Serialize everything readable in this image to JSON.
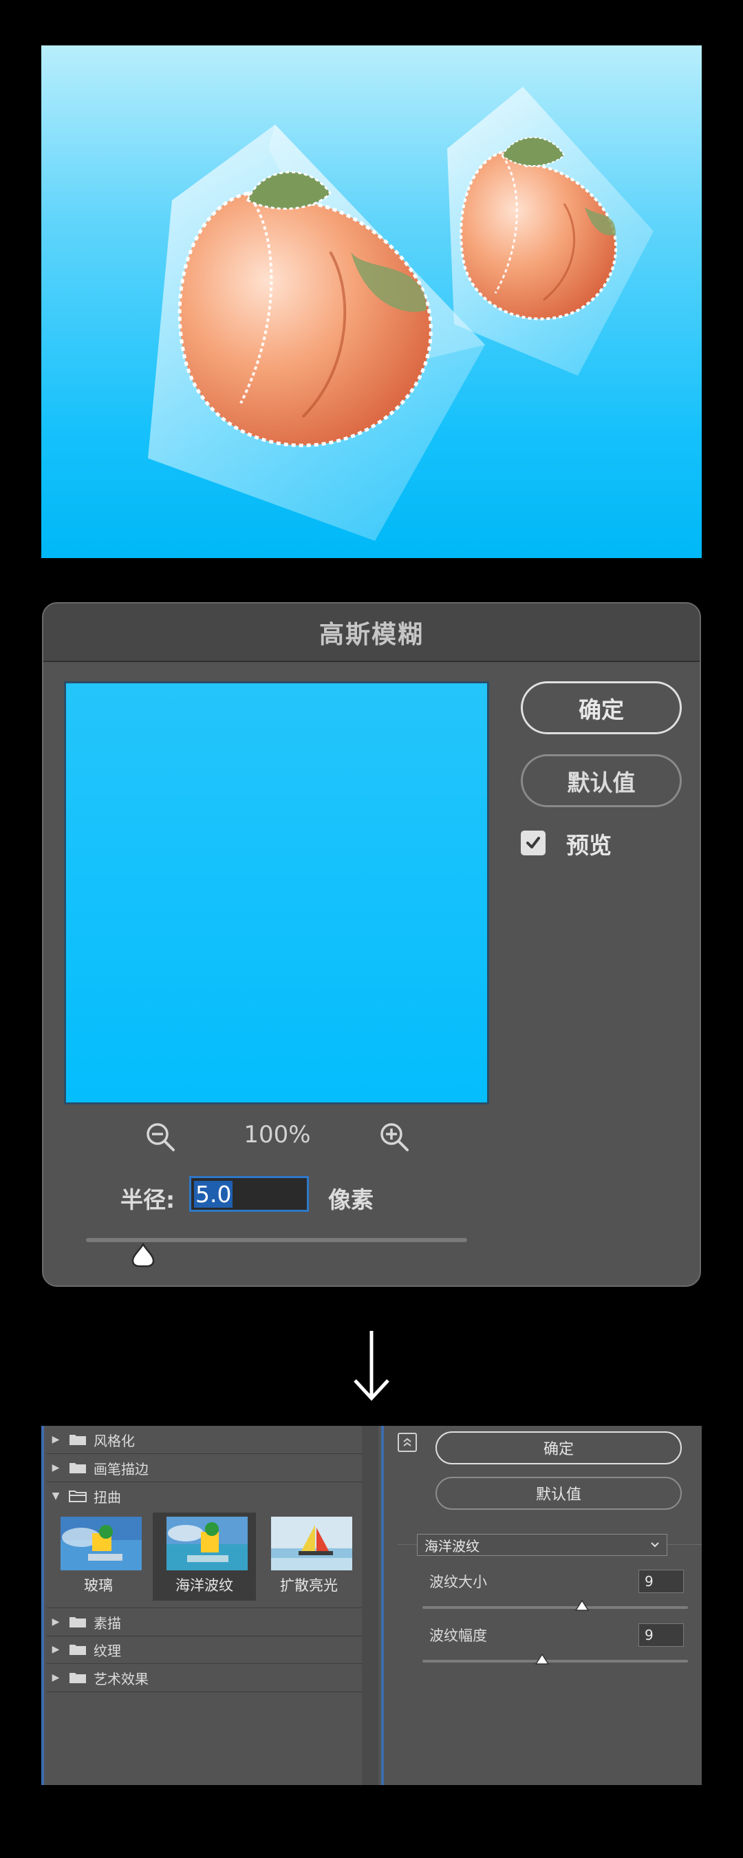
{
  "blur_dialog": {
    "title": "高斯模糊",
    "ok_label": "确定",
    "default_label": "默认值",
    "preview_label": "预览",
    "preview_checked": true,
    "zoom": "100%",
    "radius_label": "半径:",
    "radius_value": "5.0",
    "radius_unit": "像素",
    "radius_slider_fraction": 0.15
  },
  "filter_gallery": {
    "categories": [
      {
        "label": "风格化",
        "expanded": false
      },
      {
        "label": "画笔描边",
        "expanded": false
      },
      {
        "label": "扭曲",
        "expanded": true
      },
      {
        "label": "素描",
        "expanded": false
      },
      {
        "label": "纹理",
        "expanded": false
      },
      {
        "label": "艺术效果",
        "expanded": false
      }
    ],
    "thumbnails": [
      {
        "label": "玻璃",
        "selected": false
      },
      {
        "label": "海洋波纹",
        "selected": true
      },
      {
        "label": "扩散亮光",
        "selected": false
      }
    ],
    "ok_label": "确定",
    "default_label": "默认值",
    "selected_filter": "海洋波纹",
    "params": [
      {
        "label": "波纹大小",
        "value": "9",
        "fraction": 0.6
      },
      {
        "label": "波纹幅度",
        "value": "9",
        "fraction": 0.45
      }
    ]
  },
  "colors": {
    "dialog_bg": "#535353",
    "accent_blue": "#2e78c8",
    "sky_blue": "#00b8f7"
  }
}
